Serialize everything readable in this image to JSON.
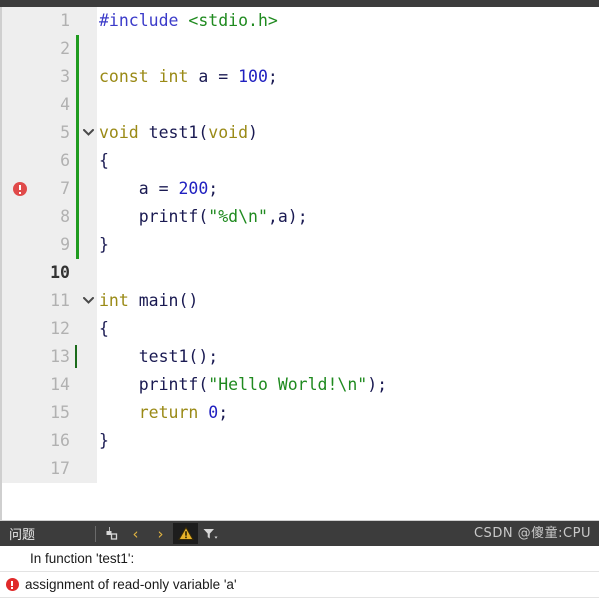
{
  "editor": {
    "language": "c",
    "gutter_bg": "#eeeeee",
    "modified_bar_color": "#1f9b1f",
    "current_line": 13,
    "lines": [
      {
        "n": "1",
        "fold": "",
        "marker": "",
        "bar": false,
        "caret": false,
        "current": false,
        "tokens": [
          {
            "t": "#include ",
            "c": "k-pre"
          },
          {
            "t": "<stdio.h>",
            "c": "k-hdr"
          }
        ]
      },
      {
        "n": "2",
        "fold": "",
        "marker": "",
        "bar": true,
        "caret": false,
        "current": false,
        "tokens": []
      },
      {
        "n": "3",
        "fold": "",
        "marker": "",
        "bar": true,
        "caret": false,
        "current": false,
        "tokens": [
          {
            "t": "const int ",
            "c": "k-type"
          },
          {
            "t": "a = ",
            "c": "k-id"
          },
          {
            "t": "100",
            "c": "k-num"
          },
          {
            "t": ";",
            "c": "k-id"
          }
        ]
      },
      {
        "n": "4",
        "fold": "",
        "marker": "",
        "bar": true,
        "caret": false,
        "current": false,
        "tokens": []
      },
      {
        "n": "5",
        "fold": "chevron-down",
        "marker": "",
        "bar": true,
        "caret": false,
        "current": false,
        "tokens": [
          {
            "t": "void ",
            "c": "k-type"
          },
          {
            "t": "test1(",
            "c": "k-id"
          },
          {
            "t": "void",
            "c": "k-type"
          },
          {
            "t": ")",
            "c": "k-id"
          }
        ]
      },
      {
        "n": "6",
        "fold": "",
        "marker": "",
        "bar": true,
        "caret": false,
        "current": false,
        "tokens": [
          {
            "t": "{",
            "c": "k-id"
          }
        ]
      },
      {
        "n": "7",
        "fold": "",
        "marker": "error",
        "bar": true,
        "caret": false,
        "current": false,
        "tokens": [
          {
            "t": "    a = ",
            "c": "k-id"
          },
          {
            "t": "200",
            "c": "k-num"
          },
          {
            "t": ";",
            "c": "k-id"
          }
        ]
      },
      {
        "n": "8",
        "fold": "",
        "marker": "",
        "bar": true,
        "caret": false,
        "current": false,
        "tokens": [
          {
            "t": "    printf(",
            "c": "k-id"
          },
          {
            "t": "\"%d\\n\"",
            "c": "k-str"
          },
          {
            "t": ",a);",
            "c": "k-id"
          }
        ]
      },
      {
        "n": "9",
        "fold": "",
        "marker": "",
        "bar": true,
        "caret": false,
        "current": false,
        "tokens": [
          {
            "t": "}",
            "c": "k-id"
          }
        ]
      },
      {
        "n": "10",
        "fold": "",
        "marker": "",
        "bar": false,
        "caret": false,
        "current": true,
        "tokens": []
      },
      {
        "n": "11",
        "fold": "chevron-down",
        "marker": "",
        "bar": false,
        "caret": false,
        "current": false,
        "tokens": [
          {
            "t": "int ",
            "c": "k-type"
          },
          {
            "t": "main()",
            "c": "k-id"
          }
        ]
      },
      {
        "n": "12",
        "fold": "",
        "marker": "",
        "bar": false,
        "caret": false,
        "current": false,
        "tokens": [
          {
            "t": "{",
            "c": "k-id"
          }
        ]
      },
      {
        "n": "13",
        "fold": "",
        "marker": "",
        "bar": false,
        "caret": true,
        "current": false,
        "tokens": [
          {
            "t": "    test1();",
            "c": "k-id"
          }
        ]
      },
      {
        "n": "14",
        "fold": "",
        "marker": "",
        "bar": false,
        "caret": false,
        "current": false,
        "tokens": [
          {
            "t": "    printf(",
            "c": "k-id"
          },
          {
            "t": "\"Hello World!\\n\"",
            "c": "k-str"
          },
          {
            "t": ");",
            "c": "k-id"
          }
        ]
      },
      {
        "n": "15",
        "fold": "",
        "marker": "",
        "bar": false,
        "caret": false,
        "current": false,
        "tokens": [
          {
            "t": "    return ",
            "c": "k-type"
          },
          {
            "t": "0",
            "c": "k-num"
          },
          {
            "t": ";",
            "c": "k-id"
          }
        ]
      },
      {
        "n": "16",
        "fold": "",
        "marker": "",
        "bar": false,
        "caret": false,
        "current": false,
        "tokens": [
          {
            "t": "}",
            "c": "k-id"
          }
        ]
      },
      {
        "n": "17",
        "fold": "",
        "marker": "",
        "bar": false,
        "caret": false,
        "current": false,
        "tokens": []
      }
    ]
  },
  "problems_panel": {
    "title": "问题",
    "toolbar": [
      {
        "name": "clear-icon",
        "glyph": "clear",
        "active": false
      },
      {
        "name": "previous-icon",
        "glyph": "‹",
        "active": false
      },
      {
        "name": "next-icon",
        "glyph": "›",
        "active": false
      },
      {
        "name": "warning-icon",
        "glyph": "warning",
        "active": true
      },
      {
        "name": "filter-icon",
        "glyph": "filter",
        "active": false
      }
    ],
    "rows": [
      {
        "icon": "",
        "text": "In function 'test1':",
        "indent": true
      },
      {
        "icon": "error",
        "text": "assignment of read-only variable 'a'",
        "indent": false
      }
    ],
    "watermark": "CSDN @傻童:CPU"
  }
}
